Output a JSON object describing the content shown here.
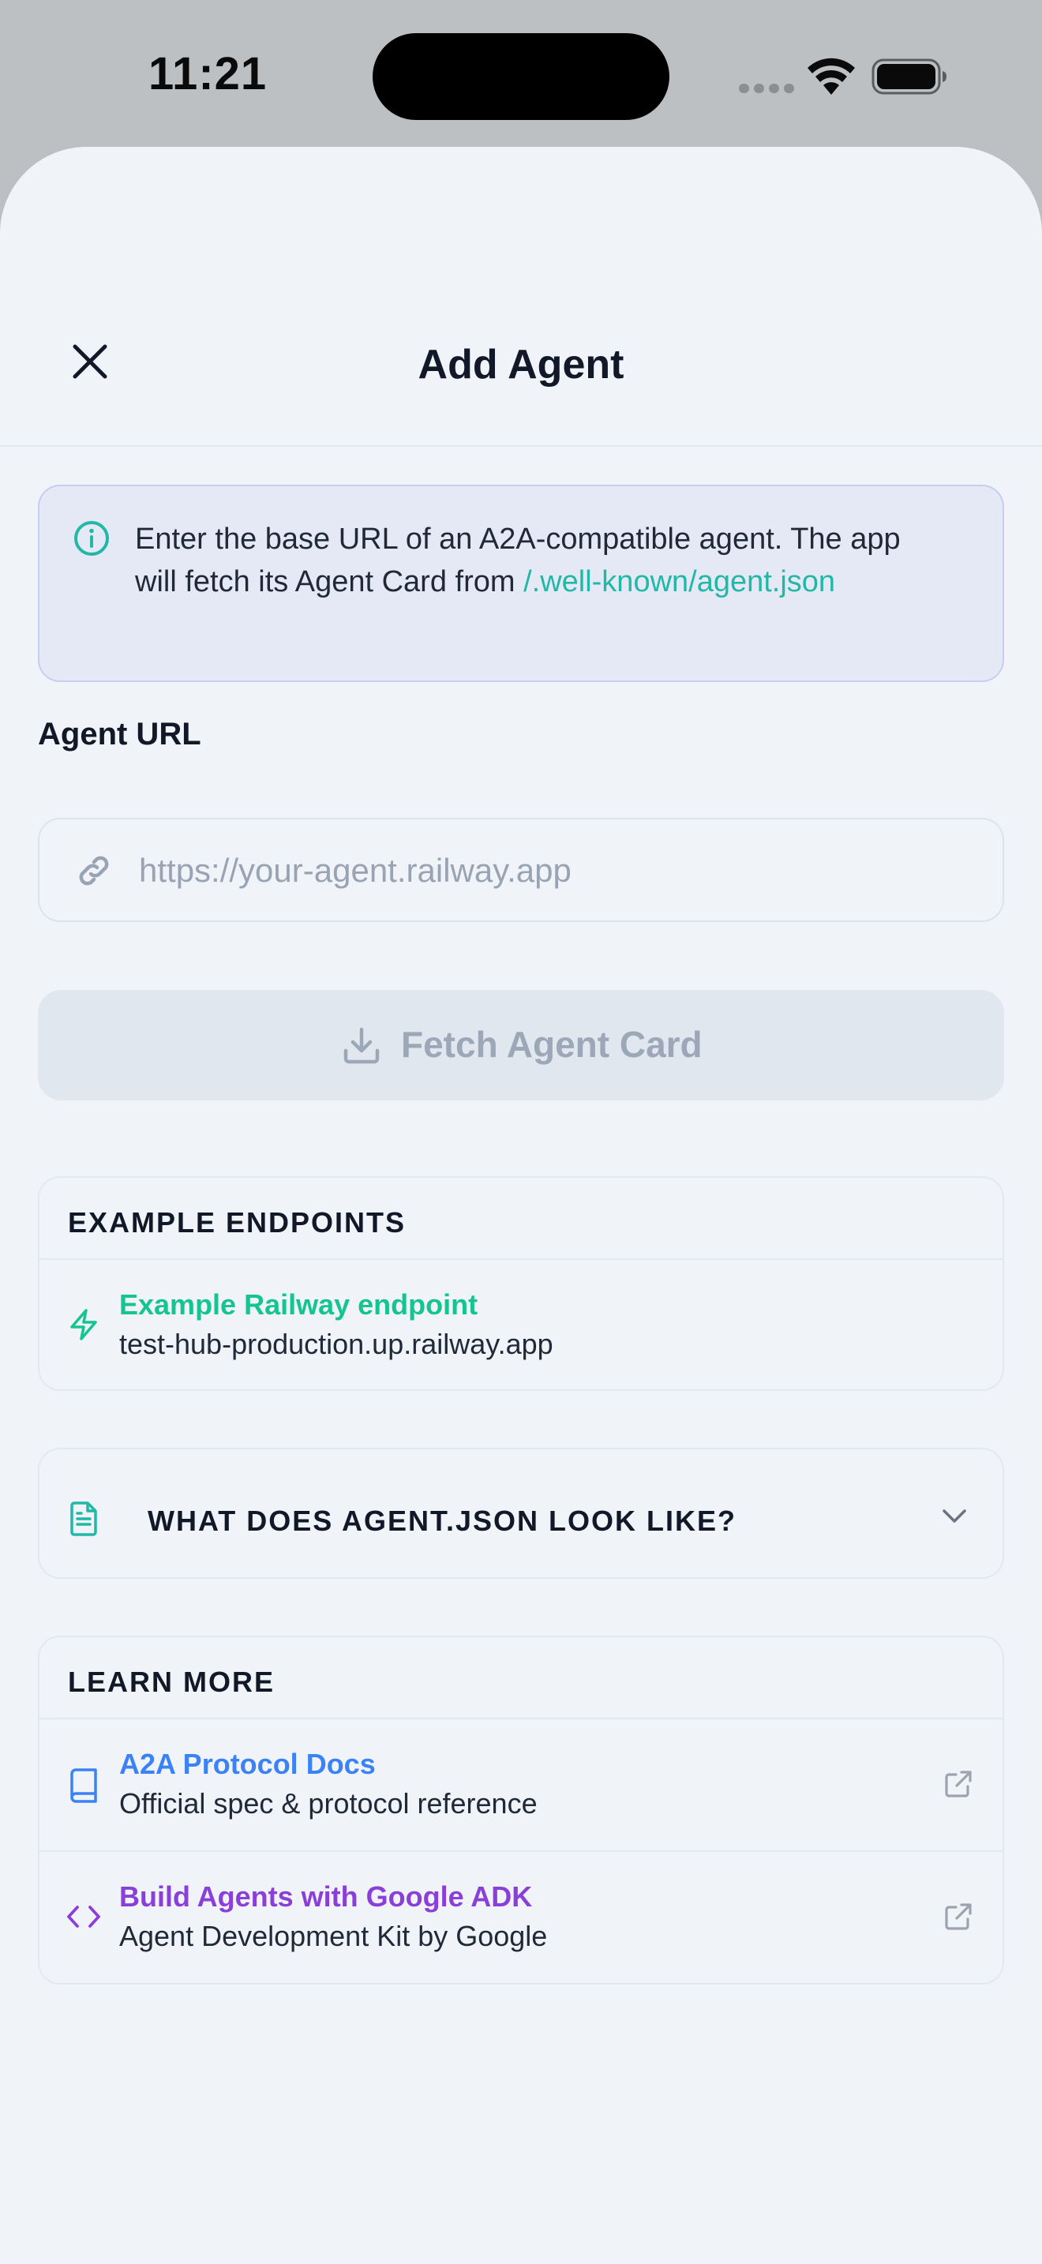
{
  "status_bar": {
    "time": "11:21"
  },
  "header": {
    "title": "Add Agent",
    "close_icon": "close-icon"
  },
  "info_box": {
    "icon": "info-icon",
    "text": "Enter the base URL of an A2A-compatible agent. The app will fetch its Agent Card from ",
    "link_text": "/.well-known/agent.json"
  },
  "url_field": {
    "label": "Agent URL",
    "value": "",
    "placeholder": "https://your-agent.railway.app",
    "icon": "link-icon"
  },
  "fetch_button": {
    "label": "Fetch Agent Card",
    "icon": "download-icon",
    "disabled": true
  },
  "example_endpoints": {
    "heading": "EXAMPLE ENDPOINTS",
    "items": [
      {
        "title": "Example Railway endpoint",
        "subtitle": "test-hub-production.up.railway.app",
        "icon": "lightning-icon"
      }
    ]
  },
  "agent_json_section": {
    "heading": "WHAT DOES AGENT.JSON LOOK LIKE?",
    "icon": "document-icon",
    "expanded": false
  },
  "learn_more": {
    "heading": "LEARN MORE",
    "items": [
      {
        "title": "A2A Protocol Docs",
        "subtitle": "Official spec & protocol reference",
        "icon": "book-icon"
      },
      {
        "title": "Build Agents with Google ADK",
        "subtitle": "Agent Development Kit by Google",
        "icon": "code-icon"
      }
    ]
  },
  "colors": {
    "accent_teal": "#21b8a7",
    "accent_green": "#16c48e",
    "accent_blue": "#3b82f6",
    "accent_purple": "#8b3fd9",
    "background": "#f0f4f9"
  }
}
